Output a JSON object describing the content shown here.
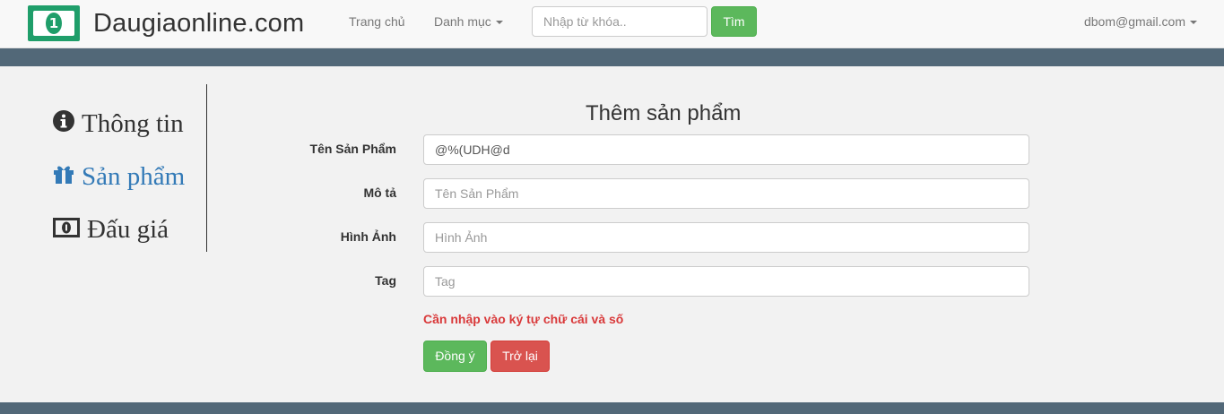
{
  "navbar": {
    "brand": "Daugiaonline.com",
    "logo_digit": "1",
    "links": {
      "home": "Trang chủ",
      "categories": "Danh mục"
    },
    "search": {
      "placeholder": "Nhập từ khóa..",
      "button": "Tìm"
    },
    "user_email": "dbom@gmail.com"
  },
  "sidebar": {
    "items": [
      {
        "label": "Thông tin",
        "icon": "info-circle-icon",
        "active": false
      },
      {
        "label": "Sản phẩm",
        "icon": "gift-icon",
        "active": true
      },
      {
        "label": "Đấu giá",
        "icon": "money-icon",
        "active": false
      }
    ]
  },
  "form": {
    "title": "Thêm sản phẩm",
    "fields": [
      {
        "label": "Tên Sản Phẩm",
        "value": "@%(UDH@d",
        "placeholder": ""
      },
      {
        "label": "Mô tả",
        "value": "",
        "placeholder": "Tên Sản Phẩm"
      },
      {
        "label": "Hình Ảnh",
        "value": "",
        "placeholder": "Hình Ảnh"
      },
      {
        "label": "Tag",
        "value": "",
        "placeholder": "Tag"
      }
    ],
    "error": "Cần nhập vào ký tự chữ cái và số",
    "submit": "Đồng ý",
    "back": "Trở lại"
  },
  "colors": {
    "band": "#526878",
    "brand_green": "#1f9e6a",
    "success": "#5cb85c",
    "danger": "#d9534f",
    "active_link": "#337ab7",
    "error_text": "#d9393a"
  }
}
